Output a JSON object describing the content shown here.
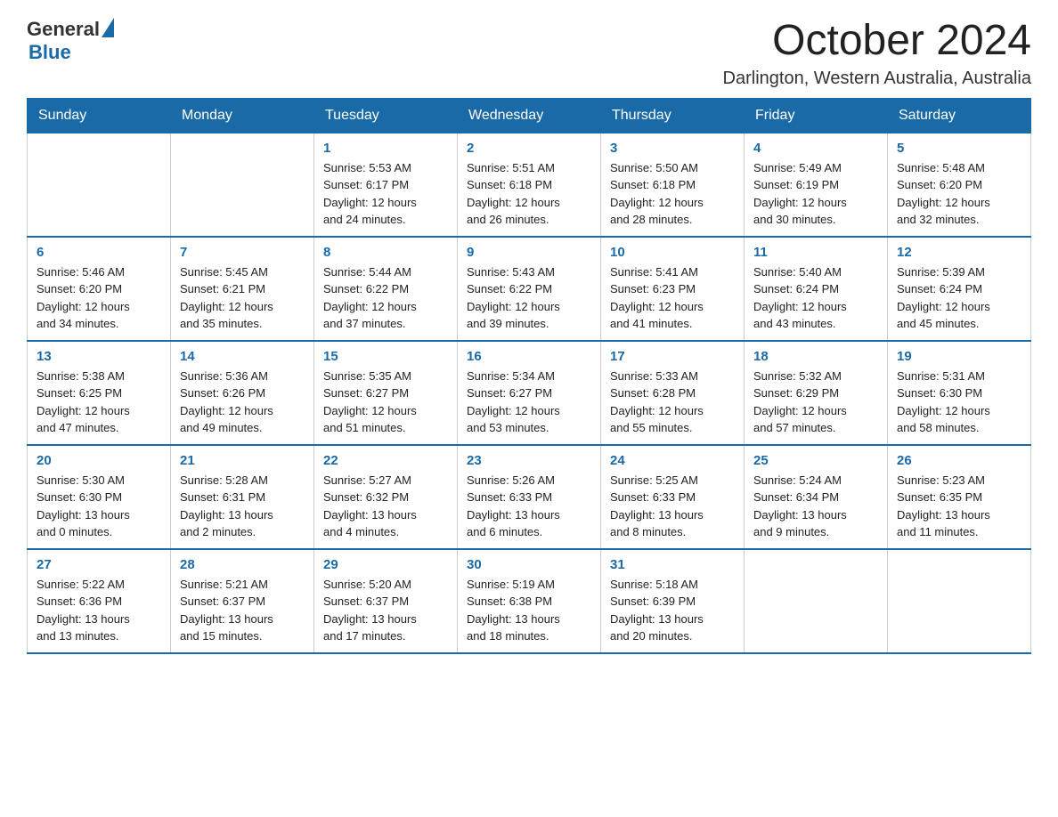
{
  "header": {
    "logo_general": "General",
    "logo_blue": "Blue",
    "month_title": "October 2024",
    "location": "Darlington, Western Australia, Australia"
  },
  "weekdays": [
    "Sunday",
    "Monday",
    "Tuesday",
    "Wednesday",
    "Thursday",
    "Friday",
    "Saturday"
  ],
  "weeks": [
    [
      {
        "day": "",
        "info": ""
      },
      {
        "day": "",
        "info": ""
      },
      {
        "day": "1",
        "info": "Sunrise: 5:53 AM\nSunset: 6:17 PM\nDaylight: 12 hours\nand 24 minutes."
      },
      {
        "day": "2",
        "info": "Sunrise: 5:51 AM\nSunset: 6:18 PM\nDaylight: 12 hours\nand 26 minutes."
      },
      {
        "day": "3",
        "info": "Sunrise: 5:50 AM\nSunset: 6:18 PM\nDaylight: 12 hours\nand 28 minutes."
      },
      {
        "day": "4",
        "info": "Sunrise: 5:49 AM\nSunset: 6:19 PM\nDaylight: 12 hours\nand 30 minutes."
      },
      {
        "day": "5",
        "info": "Sunrise: 5:48 AM\nSunset: 6:20 PM\nDaylight: 12 hours\nand 32 minutes."
      }
    ],
    [
      {
        "day": "6",
        "info": "Sunrise: 5:46 AM\nSunset: 6:20 PM\nDaylight: 12 hours\nand 34 minutes."
      },
      {
        "day": "7",
        "info": "Sunrise: 5:45 AM\nSunset: 6:21 PM\nDaylight: 12 hours\nand 35 minutes."
      },
      {
        "day": "8",
        "info": "Sunrise: 5:44 AM\nSunset: 6:22 PM\nDaylight: 12 hours\nand 37 minutes."
      },
      {
        "day": "9",
        "info": "Sunrise: 5:43 AM\nSunset: 6:22 PM\nDaylight: 12 hours\nand 39 minutes."
      },
      {
        "day": "10",
        "info": "Sunrise: 5:41 AM\nSunset: 6:23 PM\nDaylight: 12 hours\nand 41 minutes."
      },
      {
        "day": "11",
        "info": "Sunrise: 5:40 AM\nSunset: 6:24 PM\nDaylight: 12 hours\nand 43 minutes."
      },
      {
        "day": "12",
        "info": "Sunrise: 5:39 AM\nSunset: 6:24 PM\nDaylight: 12 hours\nand 45 minutes."
      }
    ],
    [
      {
        "day": "13",
        "info": "Sunrise: 5:38 AM\nSunset: 6:25 PM\nDaylight: 12 hours\nand 47 minutes."
      },
      {
        "day": "14",
        "info": "Sunrise: 5:36 AM\nSunset: 6:26 PM\nDaylight: 12 hours\nand 49 minutes."
      },
      {
        "day": "15",
        "info": "Sunrise: 5:35 AM\nSunset: 6:27 PM\nDaylight: 12 hours\nand 51 minutes."
      },
      {
        "day": "16",
        "info": "Sunrise: 5:34 AM\nSunset: 6:27 PM\nDaylight: 12 hours\nand 53 minutes."
      },
      {
        "day": "17",
        "info": "Sunrise: 5:33 AM\nSunset: 6:28 PM\nDaylight: 12 hours\nand 55 minutes."
      },
      {
        "day": "18",
        "info": "Sunrise: 5:32 AM\nSunset: 6:29 PM\nDaylight: 12 hours\nand 57 minutes."
      },
      {
        "day": "19",
        "info": "Sunrise: 5:31 AM\nSunset: 6:30 PM\nDaylight: 12 hours\nand 58 minutes."
      }
    ],
    [
      {
        "day": "20",
        "info": "Sunrise: 5:30 AM\nSunset: 6:30 PM\nDaylight: 13 hours\nand 0 minutes."
      },
      {
        "day": "21",
        "info": "Sunrise: 5:28 AM\nSunset: 6:31 PM\nDaylight: 13 hours\nand 2 minutes."
      },
      {
        "day": "22",
        "info": "Sunrise: 5:27 AM\nSunset: 6:32 PM\nDaylight: 13 hours\nand 4 minutes."
      },
      {
        "day": "23",
        "info": "Sunrise: 5:26 AM\nSunset: 6:33 PM\nDaylight: 13 hours\nand 6 minutes."
      },
      {
        "day": "24",
        "info": "Sunrise: 5:25 AM\nSunset: 6:33 PM\nDaylight: 13 hours\nand 8 minutes."
      },
      {
        "day": "25",
        "info": "Sunrise: 5:24 AM\nSunset: 6:34 PM\nDaylight: 13 hours\nand 9 minutes."
      },
      {
        "day": "26",
        "info": "Sunrise: 5:23 AM\nSunset: 6:35 PM\nDaylight: 13 hours\nand 11 minutes."
      }
    ],
    [
      {
        "day": "27",
        "info": "Sunrise: 5:22 AM\nSunset: 6:36 PM\nDaylight: 13 hours\nand 13 minutes."
      },
      {
        "day": "28",
        "info": "Sunrise: 5:21 AM\nSunset: 6:37 PM\nDaylight: 13 hours\nand 15 minutes."
      },
      {
        "day": "29",
        "info": "Sunrise: 5:20 AM\nSunset: 6:37 PM\nDaylight: 13 hours\nand 17 minutes."
      },
      {
        "day": "30",
        "info": "Sunrise: 5:19 AM\nSunset: 6:38 PM\nDaylight: 13 hours\nand 18 minutes."
      },
      {
        "day": "31",
        "info": "Sunrise: 5:18 AM\nSunset: 6:39 PM\nDaylight: 13 hours\nand 20 minutes."
      },
      {
        "day": "",
        "info": ""
      },
      {
        "day": "",
        "info": ""
      }
    ]
  ]
}
